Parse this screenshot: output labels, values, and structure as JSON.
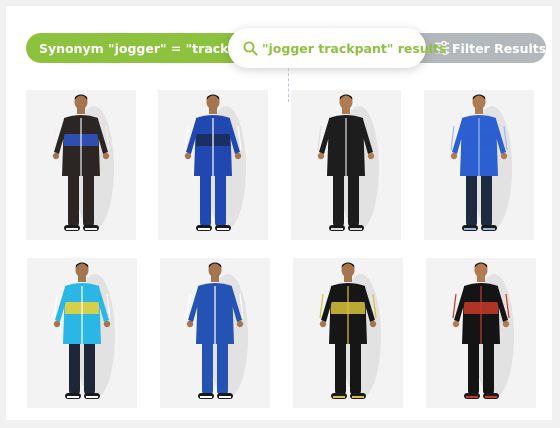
{
  "search_bar": {
    "synonym_label": "Synonym \"jogger\" = \"trackpant\"",
    "query_label": "\"jogger trackpant\" results",
    "filter_label": "Filter Results"
  },
  "icons": {
    "search": "search-icon",
    "filter": "sliders-icon"
  },
  "colors": {
    "accent_green": "#8dc23f",
    "filter_gray": "#b3b8bd"
  },
  "products": [
    {
      "jacket": "#2b2623",
      "accent": "#2f56c9",
      "pants": "#2b2623",
      "trim": "#f0f0f0",
      "skin": "#a57550"
    },
    {
      "jacket": "#2148b0",
      "accent": "#1a2b57",
      "pants": "#2148b0",
      "trim": "#ffffff",
      "skin": "#a57550"
    },
    {
      "jacket": "#1d1d1d",
      "accent": "#1d1d1d",
      "pants": "#1d1d1d",
      "trim": "#dddddd",
      "skin": "#b07a52"
    },
    {
      "jacket": "#2c5fcf",
      "accent": "#2c5fcf",
      "pants": "#1f2a40",
      "trim": "#9fb7ea",
      "skin": "#b07a52"
    },
    {
      "jacket": "#2bb7e6",
      "accent": "#f2d530",
      "pants": "#1f2638",
      "trim": "#ffffff",
      "skin": "#a57550"
    },
    {
      "jacket": "#2453b3",
      "accent": "#2453b3",
      "pants": "#2453b3",
      "trim": "#ffffff",
      "skin": "#a57550"
    },
    {
      "jacket": "#161616",
      "accent": "#d9c33a",
      "pants": "#161616",
      "trim": "#d9c33a",
      "skin": "#a57550"
    },
    {
      "jacket": "#141414",
      "accent": "#c83a2a",
      "pants": "#141414",
      "trim": "#c83a2a",
      "skin": "#b07a52"
    }
  ]
}
